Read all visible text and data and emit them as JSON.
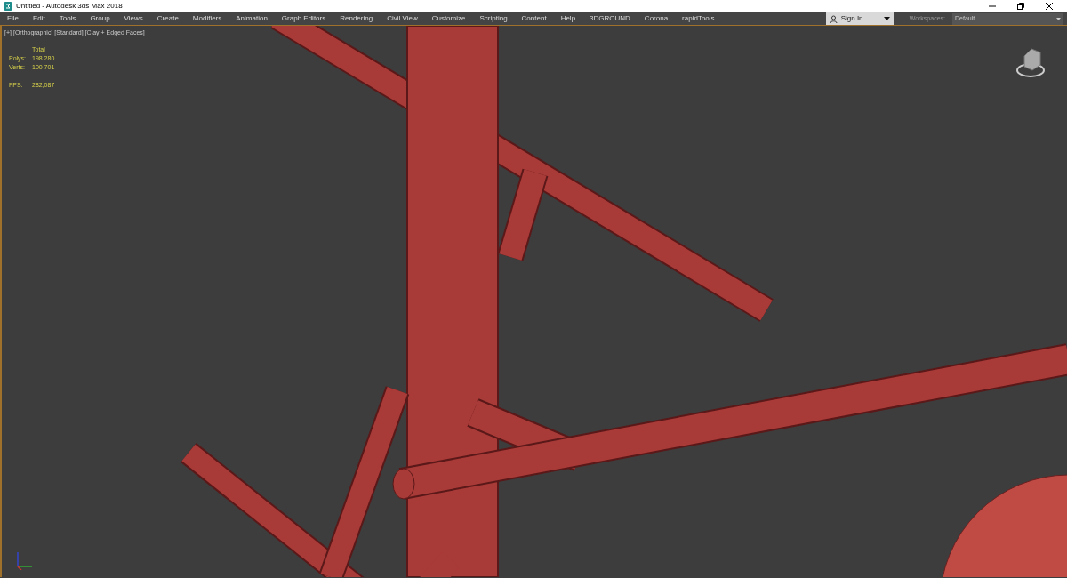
{
  "window": {
    "title": "Untitled - Autodesk 3ds Max 2018"
  },
  "menu": [
    "File",
    "Edit",
    "Tools",
    "Group",
    "Views",
    "Create",
    "Modifiers",
    "Animation",
    "Graph Editors",
    "Rendering",
    "Civil View",
    "Customize",
    "Scripting",
    "Content",
    "Help",
    "3DGROUND",
    "Corona",
    "rapidTools"
  ],
  "sign_in": {
    "label": "Sign In"
  },
  "workspaces": {
    "label": "Workspaces:",
    "value": "Default"
  },
  "viewport": {
    "labels": [
      "[+]",
      "[Orthographic]",
      "[Standard]",
      "[Clay + Edged Faces]"
    ],
    "stats": {
      "header": "Total",
      "rows": [
        {
          "label": "Polys:",
          "value": "198 280"
        },
        {
          "label": "Verts:",
          "value": "100 701"
        },
        {
          "label": "FPS:",
          "value": "282,087"
        }
      ]
    }
  }
}
